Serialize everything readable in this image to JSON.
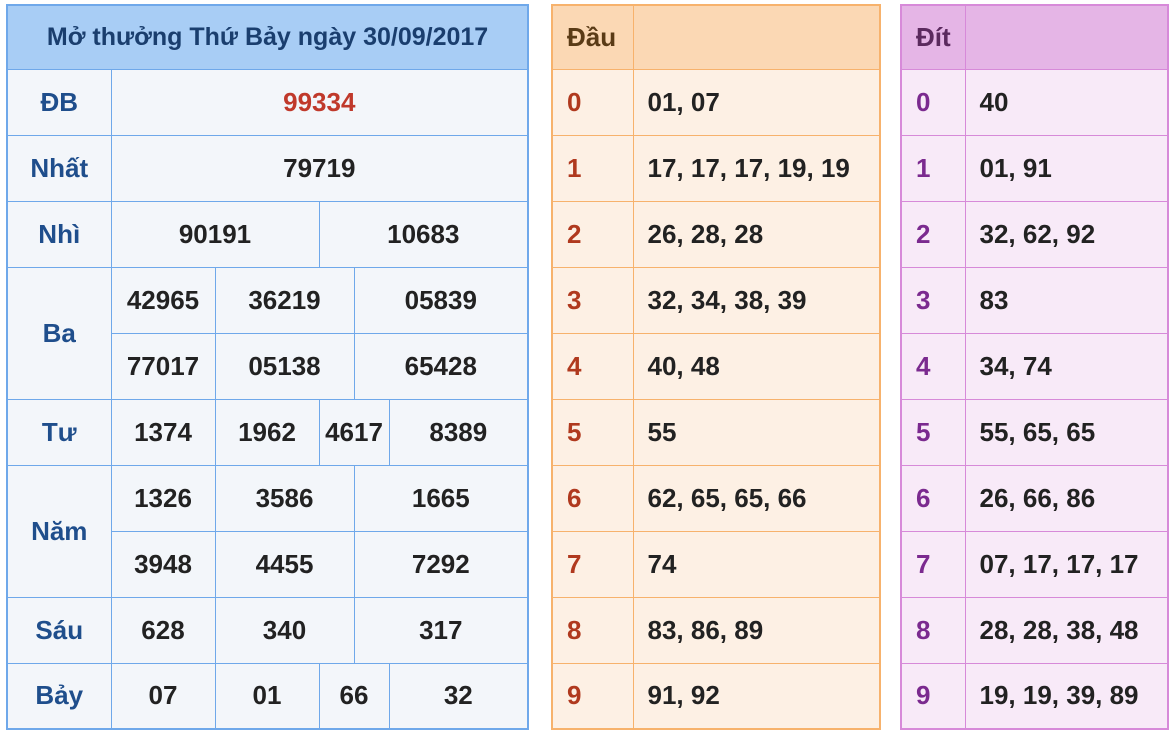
{
  "results": {
    "title": "Mở thưởng Thứ Bảy ngày 30/09/2017",
    "db": {
      "label": "ĐB",
      "values": [
        "99334"
      ]
    },
    "nhat": {
      "label": "Nhất",
      "values": [
        "79719"
      ]
    },
    "nhi": {
      "label": "Nhì",
      "values": [
        "90191",
        "10683"
      ]
    },
    "ba": {
      "label": "Ba",
      "values": [
        "42965",
        "36219",
        "05839",
        "77017",
        "05138",
        "65428"
      ]
    },
    "tu": {
      "label": "Tư",
      "values": [
        "1374",
        "1962",
        "4617",
        "8389"
      ]
    },
    "nam": {
      "label": "Năm",
      "values": [
        "1326",
        "3586",
        "1665",
        "3948",
        "4455",
        "7292"
      ]
    },
    "sau": {
      "label": "Sáu",
      "values": [
        "628",
        "340",
        "317"
      ]
    },
    "bay": {
      "label": "Bảy",
      "values": [
        "07",
        "01",
        "66",
        "32"
      ]
    },
    "special_color": "#c0392b"
  },
  "dau": {
    "header": "Đầu",
    "header_value": "",
    "rows": [
      {
        "digit": "0",
        "values": "01, 07"
      },
      {
        "digit": "1",
        "values": "17, 17, 17, 19, 19"
      },
      {
        "digit": "2",
        "values": "26, 28, 28"
      },
      {
        "digit": "3",
        "values": "32, 34, 38, 39"
      },
      {
        "digit": "4",
        "values": "40, 48"
      },
      {
        "digit": "5",
        "values": "55"
      },
      {
        "digit": "6",
        "values": "62, 65, 65, 66"
      },
      {
        "digit": "7",
        "values": "74"
      },
      {
        "digit": "8",
        "values": "83, 86, 89"
      },
      {
        "digit": "9",
        "values": "91, 92"
      }
    ]
  },
  "dit": {
    "header": "Đít",
    "header_value": "",
    "rows": [
      {
        "digit": "0",
        "values": "40"
      },
      {
        "digit": "1",
        "values": "01, 91"
      },
      {
        "digit": "2",
        "values": "32, 62, 92"
      },
      {
        "digit": "3",
        "values": "83"
      },
      {
        "digit": "4",
        "values": "34, 74"
      },
      {
        "digit": "5",
        "values": "55, 65, 65"
      },
      {
        "digit": "6",
        "values": "26, 66, 86"
      },
      {
        "digit": "7",
        "values": "07, 17, 17, 17"
      },
      {
        "digit": "8",
        "values": "28, 28, 38, 48"
      },
      {
        "digit": "9",
        "values": "19, 19, 39, 89"
      }
    ]
  }
}
